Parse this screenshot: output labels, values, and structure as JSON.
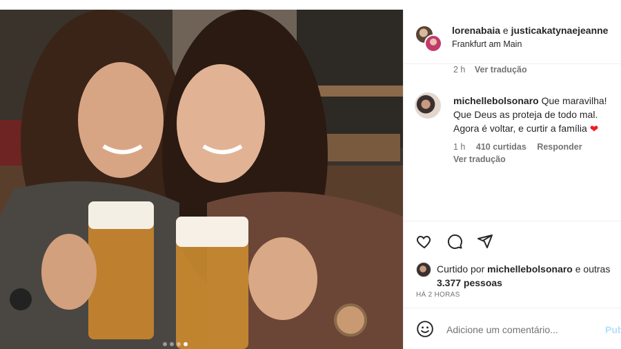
{
  "post": {
    "carousel_dots": 4,
    "active_dot": 3
  },
  "header": {
    "user1": "lorenabaia",
    "joiner": "e",
    "user2": "justicakatynaejeanne",
    "location": "Frankfurt am Main"
  },
  "caption_meta": {
    "time": "2 h",
    "translate": "Ver tradução"
  },
  "comment": {
    "username": "michellebolsonaro",
    "text": "Que maravilha! Que Deus as proteja de todo mal. Agora é voltar, e curtir a família",
    "time": "1 h",
    "likes": "410 curtidas",
    "reply": "Responder",
    "translate": "Ver tradução"
  },
  "actions": [
    "heart-icon",
    "comment-icon",
    "share-icon"
  ],
  "likes": {
    "prefix": "Curtido por",
    "user": "michellebolsonaro",
    "suffix": "e outras",
    "count": "3.377 pessoas"
  },
  "timestamp": "HÁ 2 HORAS",
  "composer": {
    "placeholder": "Adicione um comentário...",
    "publish": "Pub"
  },
  "colors": {
    "heart": "#ed1c24",
    "muted": "#737373",
    "publish": "#b2dffc"
  }
}
